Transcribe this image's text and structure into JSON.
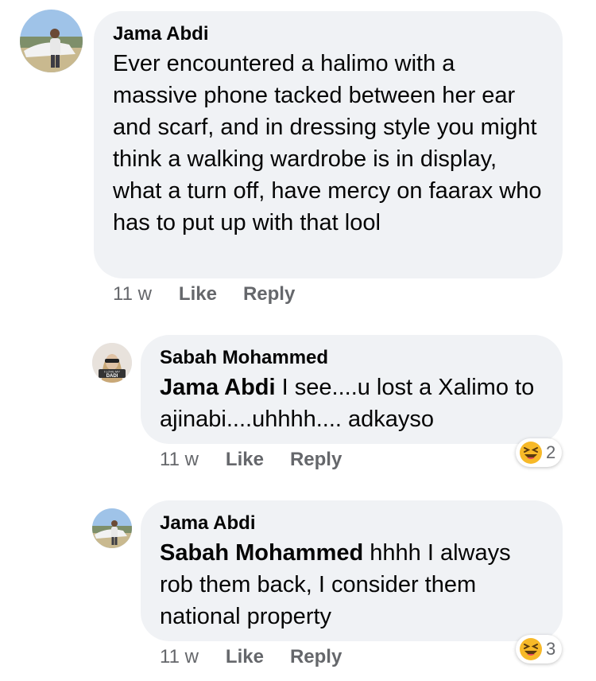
{
  "comments": [
    {
      "author": "Jama Abdi",
      "avatar_icon": "profile-photo-man-outdoors",
      "text": "Ever encountered a halimo with a massive phone tacked between her ear and scarf, and in dressing style you might think a walking wardrobe is in display, what a turn off, have mercy on faarax who has to put up with that lool",
      "time": "11 w",
      "like_label": "Like",
      "reply_label": "Reply"
    }
  ],
  "replies": [
    {
      "author": "Sabah Mohammed",
      "avatar_icon": "profile-photo-woman-sunglasses",
      "avatar_badge_text": "I LOVE MY DADI",
      "mention": "Jama Abdi",
      "text": " I see....u lost a Xalimo to ajinabi....uhhhh.... adkayso",
      "time": "11 w",
      "like_label": "Like",
      "reply_label": "Reply",
      "reaction_icon": "laughing-emoji-icon",
      "reaction_count": "2"
    },
    {
      "author": "Jama Abdi",
      "avatar_icon": "profile-photo-man-outdoors",
      "mention": "Sabah Mohammed",
      "text": " hhhh I always rob them back, I consider them national property",
      "time": "11 w",
      "like_label": "Like",
      "reply_label": "Reply",
      "reaction_icon": "laughing-emoji-icon",
      "reaction_count": "3"
    }
  ],
  "colors": {
    "bubble": "#f0f2f5",
    "meta_text": "#65676b",
    "text": "#050505",
    "emoji_yellow": "#f7b928"
  }
}
